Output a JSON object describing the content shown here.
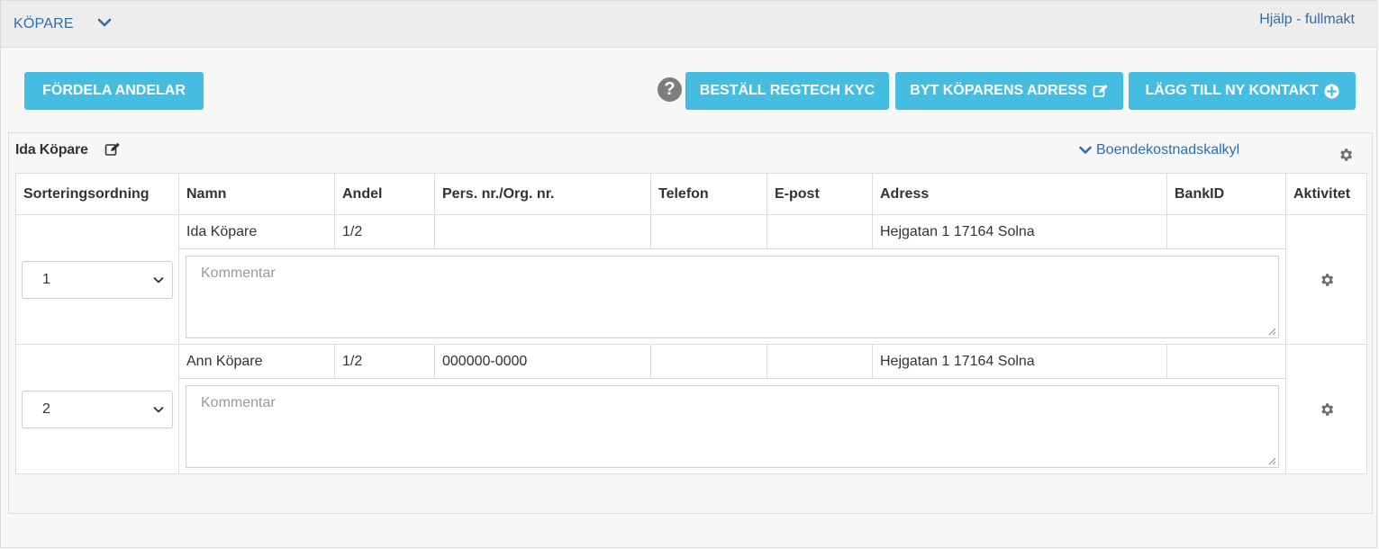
{
  "header": {
    "section_title": "KÖPARE",
    "help_link": "Hjälp - fullmakt"
  },
  "toolbar": {
    "distribute_label": "FÖRDELA ANDELAR",
    "help_icon": "?",
    "kyc_label": "BESTÄLL REGTECH KYC",
    "change_address_label": "BYT KÖPARENS ADRESS",
    "add_contact_label": "LÄGG TILL NY KONTAKT"
  },
  "panel": {
    "buyer_name": "Ida Köpare",
    "calc_link": "Boendekostnadskalkyl"
  },
  "table": {
    "columns": [
      "Sorteringsordning",
      "Namn",
      "Andel",
      "Pers. nr./Org. nr.",
      "Telefon",
      "E-post",
      "Adress",
      "BankID",
      "Aktivitet"
    ],
    "rows": [
      {
        "order": "1",
        "name": "Ida Köpare",
        "share": "1/2",
        "id_number": "",
        "phone": "",
        "email": "",
        "address": "Hejgatan 1 17164 Solna",
        "bankid": "",
        "comment_placeholder": "Kommentar"
      },
      {
        "order": "2",
        "name": "Ann Köpare",
        "share": "1/2",
        "id_number": "000000-0000",
        "phone": "",
        "email": "",
        "address": "Hejgatan 1 17164 Solna",
        "bankid": "",
        "comment_placeholder": "Kommentar"
      }
    ]
  },
  "colors": {
    "accent": "#45bde0",
    "link": "#2f6ead",
    "icon_gray": "#7d7d7d",
    "border": "#dcdcdc"
  },
  "icons": [
    "chevron-down-icon",
    "question-icon",
    "edit-icon",
    "plus-circle-icon",
    "gear-icon",
    "resize-handle-icon"
  ]
}
